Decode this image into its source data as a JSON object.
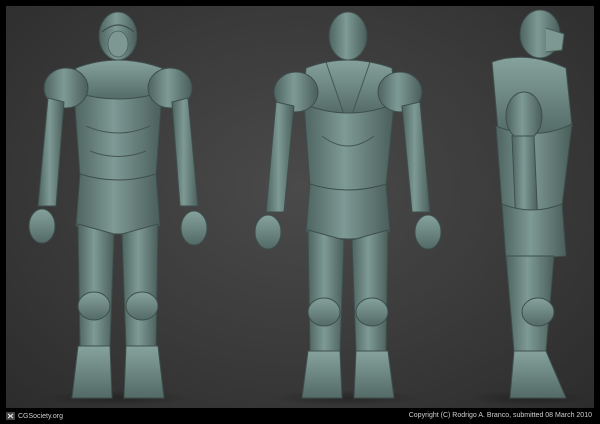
{
  "scene": {
    "views": [
      "front",
      "back",
      "side"
    ],
    "background_color": "#3b3b3b",
    "model_color": "#6f8a85"
  },
  "footer": {
    "site": "CGSociety.org",
    "credit": "Copyright (C) Rodrigo A. Branco, submitted 08 March 2010",
    "logo_icon": "cgsociety-logo-icon"
  }
}
